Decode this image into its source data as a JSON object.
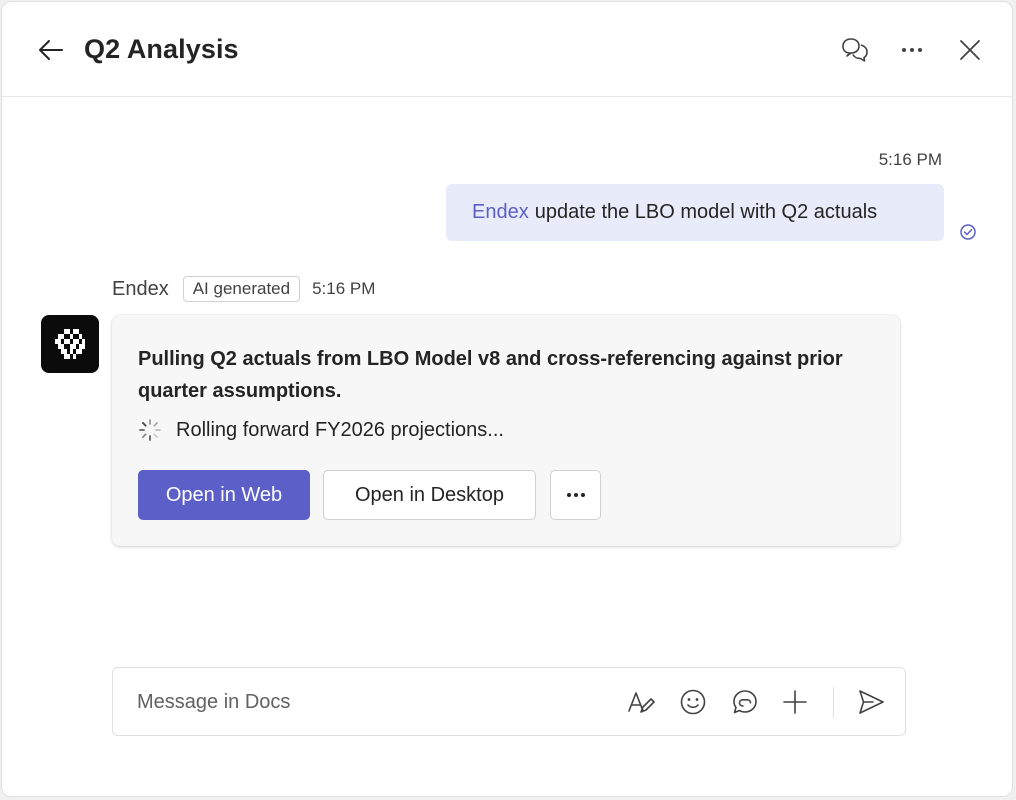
{
  "header": {
    "title": "Q2 Analysis",
    "icons": [
      "back-arrow-icon",
      "chat-bubbles-icon",
      "more-horizontal-icon",
      "close-icon"
    ]
  },
  "conversation": {
    "user_message": {
      "timestamp": "5:16 PM",
      "mention": "Endex",
      "text": "update the LBO model with Q2 actuals"
    },
    "bot_message": {
      "sender": "Endex",
      "badge": "AI generated",
      "timestamp": "5:16 PM",
      "card": {
        "title": "Pulling Q2 actuals from LBO Model v8 and cross-referencing against prior quarter assumptions.",
        "status": "Rolling forward FY2026 projections...",
        "primary_button": "Open in Web",
        "secondary_button": "Open in Desktop"
      }
    }
  },
  "composer": {
    "placeholder": "Message in Docs",
    "icons": [
      "format-text-icon",
      "emoji-icon",
      "loop-icon",
      "add-icon",
      "send-icon"
    ]
  },
  "colors": {
    "accent": "#5b5fc7",
    "user_bubble": "#e8ebfa",
    "card_bg": "#f7f7f7"
  }
}
